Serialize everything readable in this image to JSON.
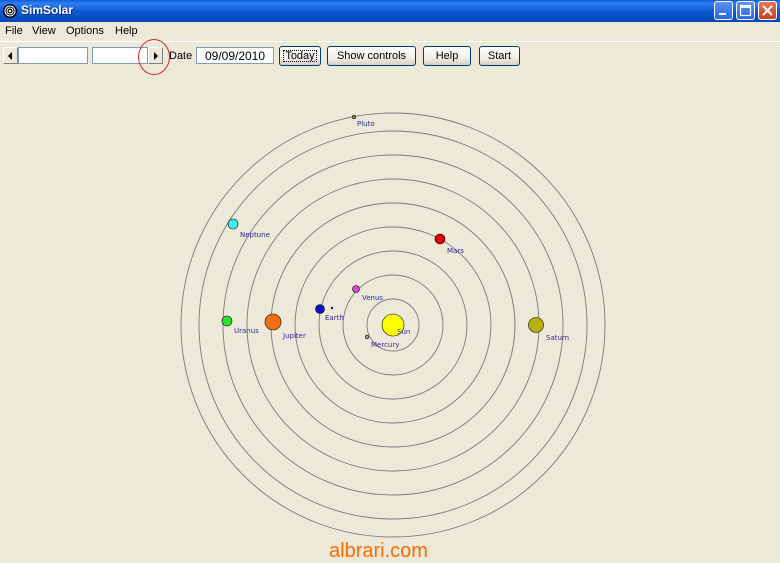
{
  "window": {
    "title": "SimSolar",
    "titlebar_color": "#0a5fd8"
  },
  "menu": {
    "items": [
      "File",
      "View",
      "Options",
      "Help"
    ]
  },
  "toolbar": {
    "field1_value": "",
    "field2_value": "",
    "date_label": "Date",
    "date_value": "09/09/2010",
    "today_label": "Today",
    "show_controls_label": "Show controls",
    "help_label": "Help",
    "start_label": "Start"
  },
  "orbits": {
    "count": 9,
    "color": "#7a7a7a"
  },
  "bodies": [
    {
      "name": "Sun",
      "color": "#ffff00"
    },
    {
      "name": "Mercury",
      "color": "#a0a0a0"
    },
    {
      "name": "Venus",
      "color": "#e040e0"
    },
    {
      "name": "Earth",
      "color": "#1010c0"
    },
    {
      "name": "Mars",
      "color": "#e00000"
    },
    {
      "name": "Jupiter",
      "color": "#f07010"
    },
    {
      "name": "Saturn",
      "color": "#b8b010"
    },
    {
      "name": "Uranus",
      "color": "#30e030"
    },
    {
      "name": "Neptune",
      "color": "#40f0f0"
    },
    {
      "name": "Pluto",
      "color": "#808080"
    }
  ],
  "watermark": "albrari.com",
  "annotation_color": "#e02020"
}
